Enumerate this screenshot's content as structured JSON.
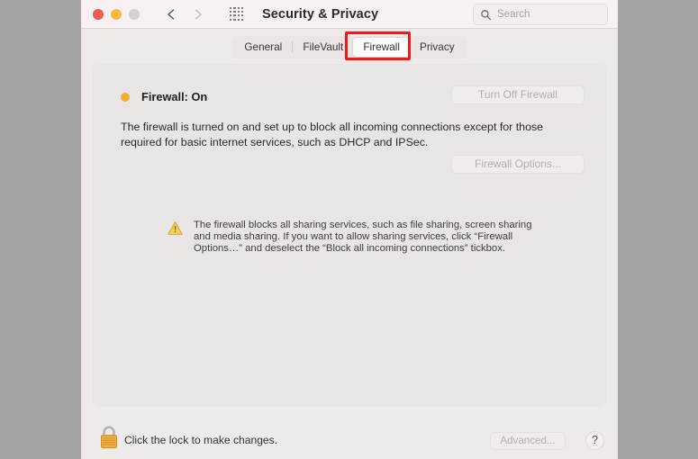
{
  "window": {
    "title": "Security & Privacy",
    "traffic_lights": [
      {
        "name": "close",
        "color": "#f05c52"
      },
      {
        "name": "minimize",
        "color": "#f3bb41"
      },
      {
        "name": "zoom",
        "color": "#d3d0d0"
      }
    ],
    "nav": {
      "back_icon": "chevron-left-icon",
      "forward_icon": "chevron-right-icon",
      "grid_icon": "grid-apps-icon"
    },
    "search": {
      "placeholder": "Search",
      "value": "",
      "icon": "search-icon"
    }
  },
  "tabs": [
    {
      "label": "General",
      "selected": false
    },
    {
      "label": "FileVault",
      "selected": false
    },
    {
      "label": "Firewall",
      "selected": true
    },
    {
      "label": "Privacy",
      "selected": false
    }
  ],
  "annotation": {
    "target": "Firewall",
    "color": "#f51616",
    "shape": "rectangle"
  },
  "firewall": {
    "status_label": "Firewall: On",
    "status_dot_color": "#f0ad30",
    "toggle_button": "Turn Off Firewall",
    "options_button": "Firewall Options...",
    "description": "The firewall is turned on and set up to block all incoming connections except for those required for basic internet services, such as DHCP and IPSec.",
    "warning": {
      "icon": "warning-triangle-icon",
      "text": "The firewall blocks all sharing services, such as file sharing, screen sharing and media sharing. If you want to allow sharing services, click “Firewall Options…” and deselect the “Block all incoming connections” tickbox."
    }
  },
  "bottom_bar": {
    "lock_icon": "padlock-closed-icon",
    "lock_text": "Click the lock to make changes.",
    "advanced_button": "Advanced...",
    "help_button": "?"
  }
}
